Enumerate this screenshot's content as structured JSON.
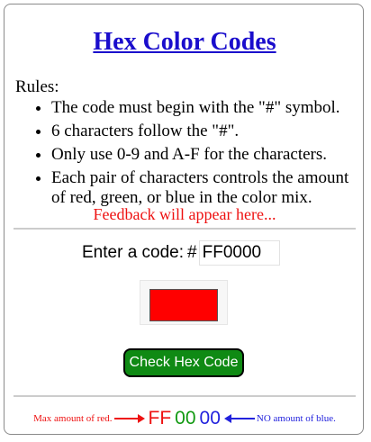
{
  "title": "Hex Color Codes",
  "rules": {
    "heading": "Rules:",
    "items": [
      "The code must begin with the \"#\" symbol.",
      "6 characters follow the \"#\".",
      "Only use 0-9 and A-F for the characters.",
      "Each pair of characters controls the amount of red, green, or blue in the color mix."
    ]
  },
  "feedback": "Feedback will appear here...",
  "input": {
    "label": "Enter a code:",
    "prefix": "#",
    "value": "FF0000",
    "placeholder": ""
  },
  "swatch": {
    "color": "#ff0000"
  },
  "check_button_label": "Check Hex Code",
  "legend": {
    "red_note": "Max amount of red.",
    "red_pair": "FF",
    "green_pair": "00",
    "blue_pair": "00",
    "blue_note": "NO amount of blue."
  },
  "colors": {
    "title": "#1a0dcc",
    "feedback": "#ee1111",
    "button_bg": "#0f8a14",
    "red": "#ee1111",
    "green": "#119911",
    "blue": "#2222dd"
  },
  "icons": {
    "right_arrow": "right-arrow-icon",
    "left_arrow": "left-arrow-icon"
  }
}
